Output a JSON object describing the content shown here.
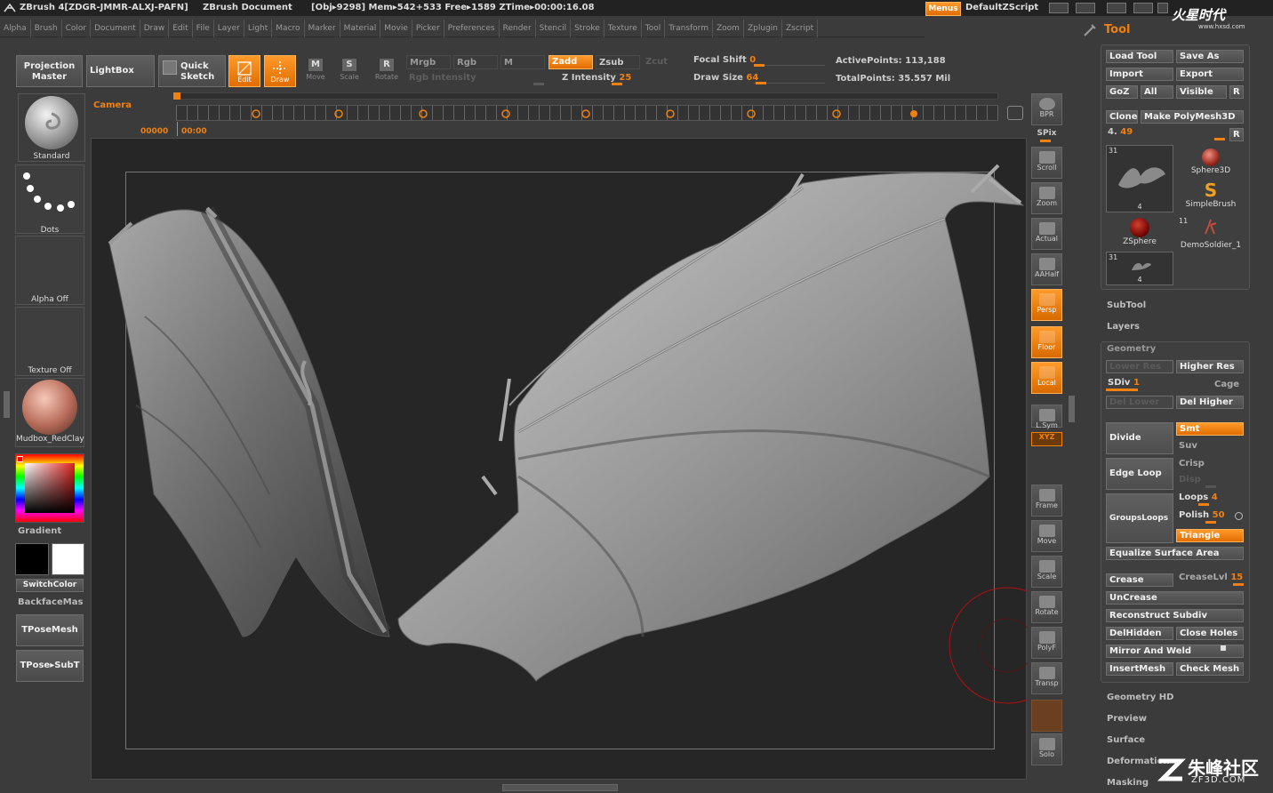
{
  "titlebar": {
    "app": "ZBrush 4[ZDGR-JMMR-ALXJ-PAFN]",
    "doc": "ZBrush Document",
    "stats": "[Obj▸9298] Mem▸542+533  Free▸1589  ZTime▸00:00:16.08",
    "menus_btn": "Menus",
    "script": "DefaultZScript"
  },
  "menubar": [
    "Alpha",
    "Brush",
    "Color",
    "Document",
    "Draw",
    "Edit",
    "File",
    "Layer",
    "Light",
    "Macro",
    "Marker",
    "Material",
    "Movie",
    "Picker",
    "Preferences",
    "Render",
    "Stencil",
    "Stroke",
    "Texture",
    "Tool",
    "Transform",
    "Zoom",
    "Zplugin",
    "Zscript"
  ],
  "toolbar": {
    "projection_master": "Projection Master",
    "lightbox": "LightBox",
    "quick_sketch": "Quick Sketch",
    "edit": "Edit",
    "draw": "Draw",
    "move": "Move",
    "scale": "Scale",
    "rotate": "Rotate",
    "mrgb": "Mrgb",
    "rgb": "Rgb",
    "m": "M",
    "rgb_intensity": "Rgb Intensity",
    "zadd": "Zadd",
    "zsub": "Zsub",
    "zcut": "Zcut",
    "z_intensity_label": "Z Intensity",
    "z_intensity_value": "25",
    "focal_shift_label": "Focal Shift",
    "focal_shift_value": "0",
    "draw_size_label": "Draw Size",
    "draw_size_value": "64",
    "active_points": "ActivePoints: 113,188",
    "total_points": "TotalPoints: 35.557 Mil"
  },
  "timeline": {
    "camera": "Camera",
    "time_start": "00000",
    "time_cur": "00:00"
  },
  "leftshelf": {
    "brush": "Standard",
    "stroke": "Dots",
    "alpha": "Alpha  Off",
    "texture": "Texture  Off",
    "material": "Mudbox_RedClay",
    "gradient": "Gradient",
    "switchcolor": "SwitchColor",
    "backface": "BackfaceMas",
    "tposemesh": "TPoseMesh",
    "tposesubt": "TPose▸SubT",
    "main_color": "#000000",
    "secondary_color": "#ffffff"
  },
  "rightshelf": [
    "BPR",
    "SPix",
    "Scroll",
    "Zoom",
    "Actual",
    "AAHalf",
    "Persp",
    "Floor",
    "Local",
    "L.Sym",
    "XYZ",
    "Frame",
    "Move",
    "Scale",
    "Rotate",
    "PolyF",
    "Transp",
    "Solo"
  ],
  "toolpanel": {
    "title": "Tool",
    "load_tool": "Load Tool",
    "save_as": "Save As",
    "import": "Import",
    "export": "Export",
    "goz": "GoZ",
    "all": "All",
    "visible": "Visible",
    "r": "R",
    "clone": "Clone",
    "make_polymesh": "Make PolyMesh3D",
    "slider_label": "4.",
    "slider_value": "49",
    "tools": [
      {
        "name": "",
        "count": "31",
        "sub": "4"
      },
      {
        "name": "Sphere3D",
        "count": "",
        "sub": ""
      },
      {
        "name": "SimpleBrush",
        "count": "",
        "sub": ""
      },
      {
        "name": "ZSphere",
        "count": "",
        "sub": ""
      },
      {
        "name": "DemoSoldier_1",
        "count": "11",
        "sub": ""
      },
      {
        "name": "",
        "count": "31",
        "sub": "4"
      }
    ],
    "subtool": "SubTool",
    "layers": "Layers",
    "geometry": "Geometry",
    "lower_res": "Lower Res",
    "higher_res": "Higher Res",
    "sdiv_label": "SDiv",
    "sdiv_value": "1",
    "cage": "Cage",
    "del_lower": "Del Lower",
    "del_higher": "Del Higher",
    "divide": "Divide",
    "smt": "Smt",
    "suv": "Suv",
    "edge_loop": "Edge Loop",
    "crisp": "Crisp",
    "disp": "Disp",
    "groupsloops": "GroupsLoops",
    "loops_label": "Loops",
    "loops_value": "4",
    "polish_label": "Polish",
    "polish_value": "50",
    "triangle": "Triangle",
    "equalize": "Equalize Surface Area",
    "crease": "Crease",
    "creaselvl_label": "CreaseLvl",
    "creaselvl_value": "15",
    "uncrease": "UnCrease",
    "reconstruct": "Reconstruct Subdiv",
    "delhidden": "DelHidden",
    "close_holes": "Close Holes",
    "mirror_weld": "Mirror And Weld",
    "insertmesh": "InsertMesh",
    "check_mesh": "Check Mesh",
    "geometry_hd": "Geometry HD",
    "preview": "Preview",
    "surface": "Surface",
    "deformation": "Deformation",
    "masking": "Masking"
  },
  "watermark": {
    "top": "火星时代",
    "top_url": "www.hxsd.com",
    "bottom": "朱峰社区",
    "bottom_url": "ZF3D.COM"
  },
  "accent_color": "#f07e10"
}
